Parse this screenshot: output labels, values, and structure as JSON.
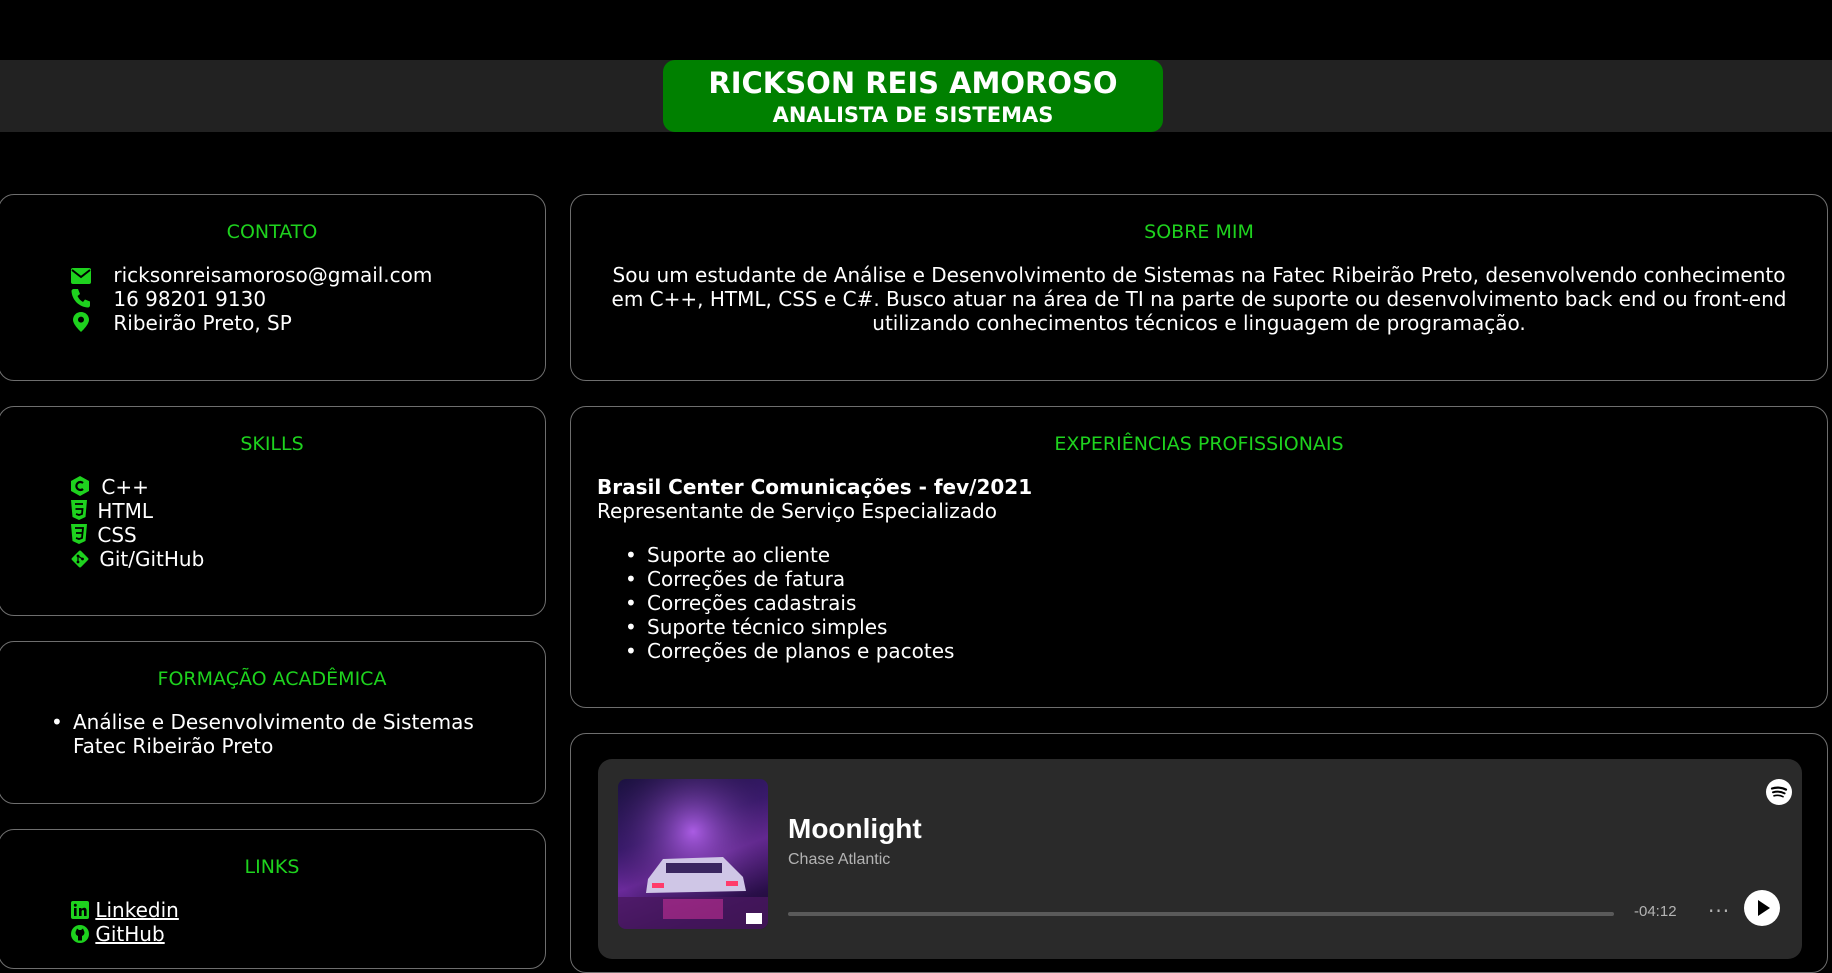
{
  "header": {
    "name": "RICKSON REIS AMOROSO",
    "role": "ANALISTA DE SISTEMAS"
  },
  "contato": {
    "title": "CONTATO",
    "email": "ricksonreisamoroso@gmail.com",
    "phone": "16 98201 9130",
    "location": "Ribeirão Preto, SP"
  },
  "skills": {
    "title": "SKILLS",
    "items": [
      "C++",
      "HTML",
      "CSS",
      "Git/GitHub"
    ]
  },
  "formacao": {
    "title": "FORMAÇÃO ACADÊMICA",
    "course": "Análise e Desenvolvimento de Sistemas",
    "school": "Fatec Ribeirão Preto"
  },
  "links": {
    "title": "LINKS",
    "items": [
      " Linkedin",
      " GitHub"
    ]
  },
  "sobre": {
    "title": "SOBRE MIM",
    "lines": [
      "Sou um estudante de Análise e Desenvolvimento de Sistemas na Fatec Ribeirão Preto, desenvolvendo conhecimento",
      "em C++, HTML, CSS e C#. Busco atuar na área de TI na parte de suporte ou desenvolvimento back end ou front-end",
      "utilizando conhecimentos técnicos e linguagem de programação."
    ]
  },
  "experiencias": {
    "title": "EXPERIÊNCIAS PROFISSIONAIS",
    "company": "Brasil Center Comunicações - fev/2021",
    "position": "Representante de Serviço Especializado",
    "tasks": [
      "Suporte ao cliente",
      "Correções de fatura",
      "Correções cadastrais",
      "Suporte técnico simples",
      "Correções de planos e pacotes"
    ]
  },
  "player": {
    "track": "Moonlight",
    "artist": "Chase Atlantic",
    "time": "-04:12",
    "progress": 0,
    "more": "···"
  },
  "colors": {
    "accent": "#1ed21e",
    "header_bg": "#008000",
    "background": "#000000"
  }
}
